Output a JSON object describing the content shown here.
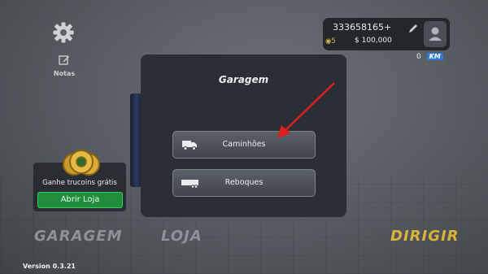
{
  "profile": {
    "id": "333658165+",
    "coins": "5",
    "money": "$ 100,000",
    "km_value": "0",
    "km_unit": "KM"
  },
  "side": {
    "notes_label": "Notas"
  },
  "modal": {
    "title": "Garagem",
    "buttons": [
      {
        "label": "Caminhões",
        "icon": "truck-icon"
      },
      {
        "label": "Reboques",
        "icon": "trailer-icon"
      }
    ]
  },
  "promo": {
    "text": "Ganhe trucoins grátis",
    "button": "Abrir Loja"
  },
  "tabs": [
    {
      "label": "GARAGEM"
    },
    {
      "label": "LOJA"
    },
    {
      "label": "DIRIGIR"
    }
  ],
  "version": "Version 0.3.21",
  "colors": {
    "accent": "#d8b23b",
    "shop_green": "#1f8d3c",
    "km_badge": "#2f7dd8",
    "arrow": "#e01e1e"
  }
}
